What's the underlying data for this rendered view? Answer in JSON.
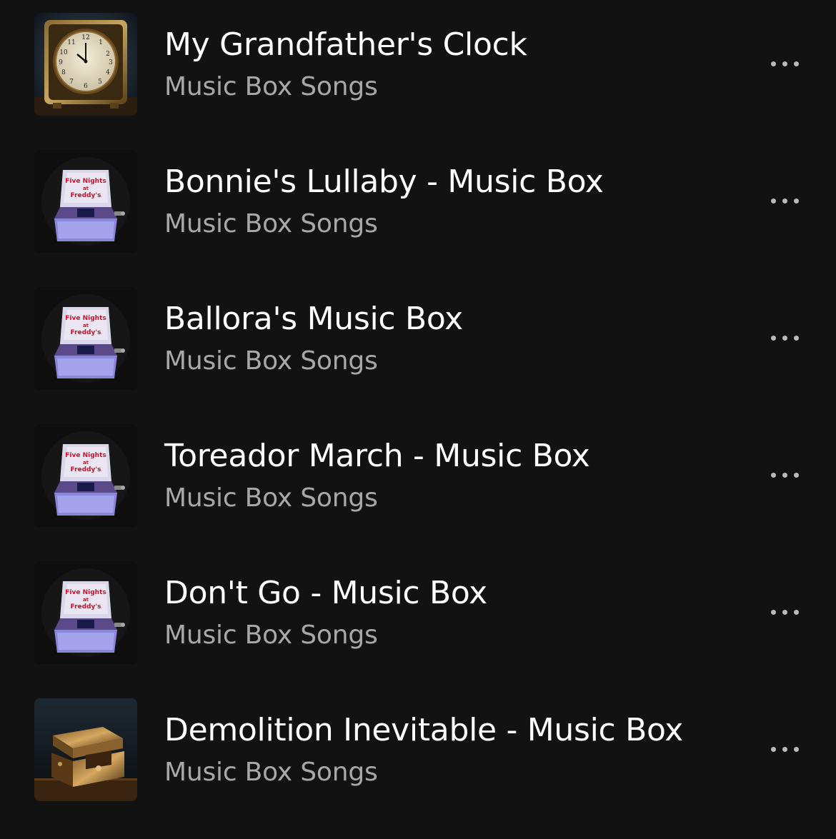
{
  "colors": {
    "background": "#121212",
    "title": "#ffffff",
    "subtitle": "#a8a8a8",
    "more_icon": "#b9b9b9"
  },
  "tracks": [
    {
      "title": "My Grandfather's Clock",
      "subtitle": "Music Box Songs",
      "artwork": "antique-clock-artwork",
      "more_icon": "more-options-icon"
    },
    {
      "title": "Bonnie's Lullaby - Music Box",
      "subtitle": "Music Box Songs",
      "artwork": "fnaf-music-box-artwork",
      "more_icon": "more-options-icon"
    },
    {
      "title": "Ballora's Music Box",
      "subtitle": "Music Box Songs",
      "artwork": "fnaf-music-box-artwork",
      "more_icon": "more-options-icon"
    },
    {
      "title": "Toreador March - Music Box",
      "subtitle": "Music Box Songs",
      "artwork": "fnaf-music-box-artwork",
      "more_icon": "more-options-icon"
    },
    {
      "title": "Don't Go - Music Box",
      "subtitle": "Music Box Songs",
      "artwork": "fnaf-music-box-artwork",
      "more_icon": "more-options-icon"
    },
    {
      "title": "Demolition Inevitable - Music Box",
      "subtitle": "Music Box Songs",
      "artwork": "ornate-music-box-artwork",
      "more_icon": "more-options-icon"
    }
  ],
  "fnaf_box_lettering": [
    "Five Nights",
    "at",
    "Freddy's"
  ]
}
